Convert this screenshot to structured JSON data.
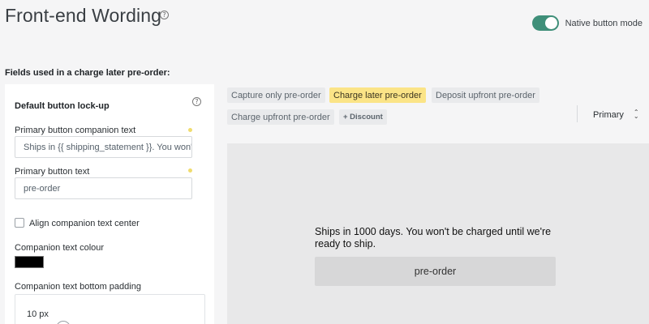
{
  "header": {
    "title": "Front-end Wording",
    "help_icon": "question-circle-icon",
    "toggle_label": "Native button mode",
    "toggle_on": true,
    "toggle_color": "#3f8f79"
  },
  "section_label": "Fields used in a charge later pre-order:",
  "left_panel": {
    "heading": "Default button lock-up",
    "companion_label": "Primary button companion text",
    "companion_value": "Ships in {{ shipping_statement }}. You won'",
    "button_text_label": "Primary button text",
    "button_text_value": "pre-order",
    "align_center_label": "Align companion text center",
    "align_center_checked": false,
    "colour_label": "Companion text colour",
    "colour_value": "#000000",
    "padding_label": "Companion text bottom padding",
    "padding_value": "10 px"
  },
  "tabs": [
    {
      "label": "Capture only pre-order",
      "active": false
    },
    {
      "label": "Charge later pre-order",
      "active": true
    },
    {
      "label": "Deposit upfront pre-order",
      "active": false
    },
    {
      "label": "Charge upfront pre-order",
      "active": false
    }
  ],
  "discount_chip": "+ Discount",
  "style_select": {
    "value": "Primary"
  },
  "preview": {
    "text": "Ships in 1000 days. You won't be charged until we're ready to ship.",
    "button_label": "pre-order"
  },
  "colors": {
    "active_tab": "#fbe487",
    "required_dot": "#f0dc6e"
  }
}
